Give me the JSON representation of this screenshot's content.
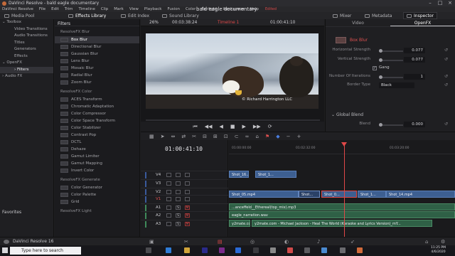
{
  "window": {
    "title": "DaVinci Resolve - bald eagle documentary"
  },
  "menu": {
    "items": [
      "DaVinci Resolve",
      "File",
      "Edit",
      "Trim",
      "Timeline",
      "Clip",
      "Mark",
      "View",
      "Playback",
      "Fusion",
      "Color",
      "Fairlight",
      "Workspace",
      "Help"
    ],
    "project_title": "bald eagle documentary",
    "edited_label": "Edited"
  },
  "toolbar": {
    "media_pool": "Media Pool",
    "effects_library": "Effects Library",
    "edit_index": "Edit Index",
    "sound_library": "Sound Library",
    "mixer": "Mixer",
    "metadata": "Metadata",
    "inspector": "Inspector"
  },
  "left_tree": [
    {
      "label": "Toolbox",
      "level": 0,
      "glyph": "⌄"
    },
    {
      "label": "Video Transitions",
      "level": 1
    },
    {
      "label": "Audio Transitions",
      "level": 1
    },
    {
      "label": "Titles",
      "level": 1
    },
    {
      "label": "Generators",
      "level": 1
    },
    {
      "label": "Effects",
      "level": 1
    },
    {
      "label": "OpenFX",
      "level": 0,
      "glyph": "⌄"
    },
    {
      "label": "Filters",
      "level": 1,
      "selected": true,
      "glyph": "›"
    },
    {
      "label": "Audio FX",
      "level": 0,
      "glyph": "›"
    }
  ],
  "favorites_label": "Favorites",
  "filters_panel": {
    "header": "Filters",
    "categories": [
      {
        "name": "ResolveFX Blur",
        "items": [
          "Box Blur",
          "Directional Blur",
          "Gaussian Blur",
          "Lens Blur",
          "Mosaic Blur",
          "Radial Blur",
          "Zoom Blur"
        ]
      },
      {
        "name": "ResolveFX Color",
        "items": [
          "ACES Transform",
          "Chromatic Adaptation",
          "Color Compressor",
          "Color Space Transform",
          "Color Stabilizer",
          "Contrast Pop",
          "DCTL",
          "Dehaze",
          "Gamut Limiter",
          "Gamut Mapping",
          "Invert Color"
        ]
      },
      {
        "name": "ResolveFX Generate",
        "items": [
          "Color Generator",
          "Color Palette",
          "Grid"
        ]
      },
      {
        "name": "ResolveFX Light",
        "items": []
      }
    ],
    "selected": "Box Blur"
  },
  "viewer": {
    "zoom": "26%",
    "source_timecode": "00:03:38:24",
    "timeline_name": "Timeline 1",
    "record_timecode": "01:00:41:10",
    "watermark": "© Richard Harrington LLC",
    "transport": [
      "⏮",
      "◀◀",
      "◀",
      "■",
      "▶",
      "▶▶",
      "⟳"
    ]
  },
  "inspector": {
    "tabs": [
      "Video",
      "OpenFX"
    ],
    "active_tab": "OpenFX",
    "effect_name": "Box Blur",
    "params": [
      {
        "label": "Horizontal Strength",
        "value": "0.077"
      },
      {
        "label": "Vertical Strength",
        "value": "0.077"
      },
      {
        "label": "Gang",
        "checked": true
      },
      {
        "label": "Number Of Iterations",
        "value": "1"
      },
      {
        "label": "Border Type",
        "value": "Black"
      }
    ],
    "global_blend": {
      "header": "Global Blend",
      "blend_label": "Blend",
      "blend_value": "0.000"
    }
  },
  "timeline": {
    "timecode": "01:00:41:10",
    "ruler_labels": [
      "01:00:00:00",
      "01:02:32:00",
      "01:03:20:00"
    ],
    "tracks": [
      {
        "name": "V4",
        "type": "video"
      },
      {
        "name": "V3",
        "type": "video"
      },
      {
        "name": "V2",
        "type": "video"
      },
      {
        "name": "V1",
        "type": "video",
        "active": true
      },
      {
        "name": "A1",
        "type": "audio"
      },
      {
        "name": "A2",
        "type": "audio"
      },
      {
        "name": "A3",
        "type": "audio"
      }
    ],
    "track_button_labels": {
      "lock": "🔒",
      "solo": "S",
      "mute": "M"
    },
    "clips": {
      "v4_a": "Shot_16...",
      "v4_b": "Shot_1...",
      "v2_a": "Shot_05.mp4",
      "v2_b": "Shot...",
      "v2_sel": "Shot_0...",
      "v2_c": "Shot_1...",
      "v2_d": "Shot_14.mp4",
      "a1": "...anceffeld__Ethereal(top_mix).mp3",
      "a2": "eagle_narration.wav",
      "a3_a": "y2mate.com...",
      "a3_b": "y2mate.com - Michael Jackson - Heal The World (Karaoke and Lyrics Version)_mY..."
    }
  },
  "page_bar": {
    "app_name": "DaVinci Resolve 16"
  },
  "taskbar": {
    "search_placeholder": "Type here to search",
    "time": "11:25 PM",
    "date": "4/6/2020"
  },
  "colors": {
    "accent_red": "#e04848",
    "video_clip": "#3d5f91",
    "audio_clip": "#2f6046"
  }
}
